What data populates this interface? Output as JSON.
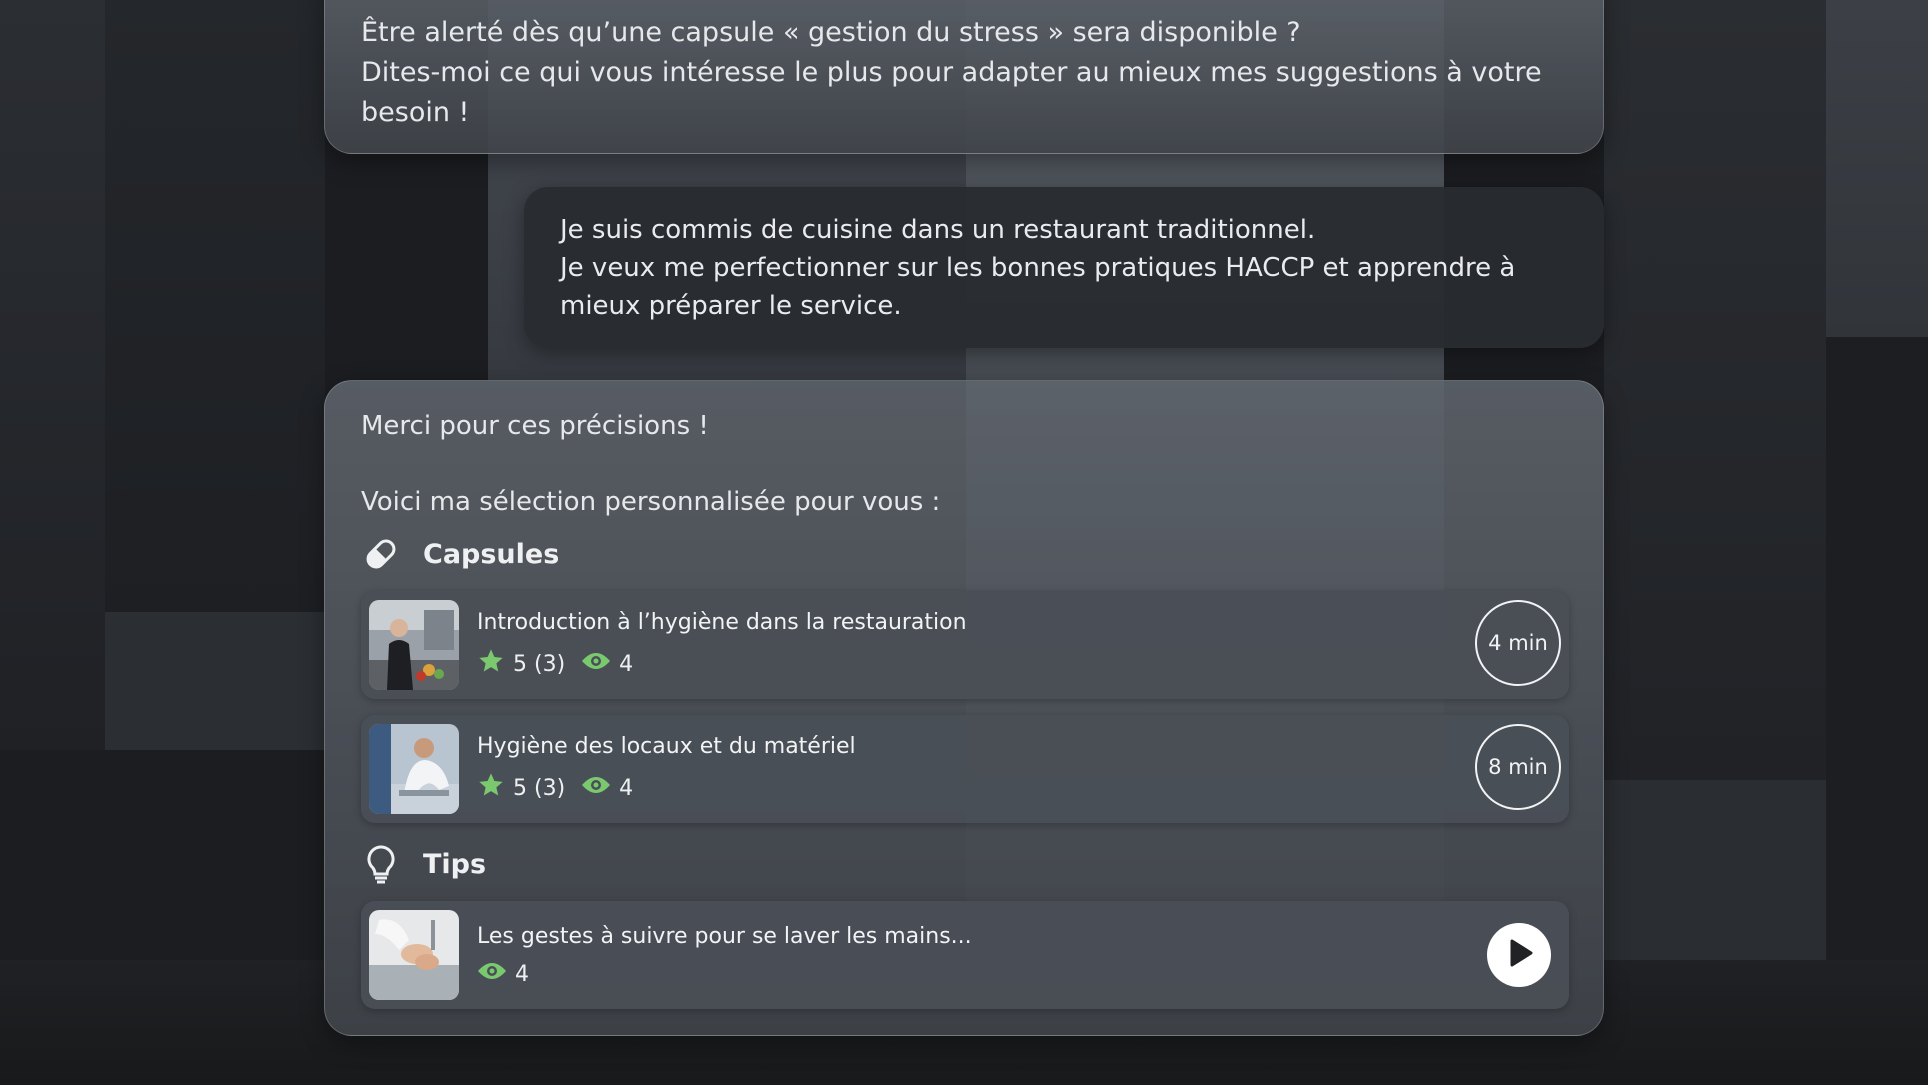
{
  "conversation": {
    "bot_message_1": {
      "lines": [
        "Être alerté dès qu’une capsule « gestion du stress » sera disponible ?",
        "Dites-moi ce qui vous intéresse le plus pour adapter au mieux mes suggestions à votre",
        "besoin !"
      ]
    },
    "user_message": {
      "lines": [
        "Je suis commis de cuisine dans un restaurant traditionnel.",
        "Je veux me perfectionner sur les bonnes pratiques HACCP et apprendre à",
        "mieux préparer le service."
      ]
    },
    "bot_message_2": {
      "intro": "Merci pour ces précisions !",
      "selection_text": "Voici ma sélection personnalisée pour vous :",
      "capsules_heading": "Capsules",
      "capsules_icon": "pill-icon",
      "capsules": [
        {
          "title": "Introduction à l’hygiène dans la restauration",
          "rating": "5 (3)",
          "views": "4",
          "duration": "4 min"
        },
        {
          "title": "Hygiène des locaux et du matériel",
          "rating": "5 (3)",
          "views": "4",
          "duration": "8 min"
        }
      ],
      "tips_heading": "Tips",
      "tips_icon": "lightbulb-icon",
      "tips": [
        {
          "title": "Les gestes à suivre pour se laver les mains...",
          "views": "4"
        }
      ]
    }
  },
  "colors": {
    "accent_green": "#7bc96f",
    "play_button": "#ffffff"
  }
}
